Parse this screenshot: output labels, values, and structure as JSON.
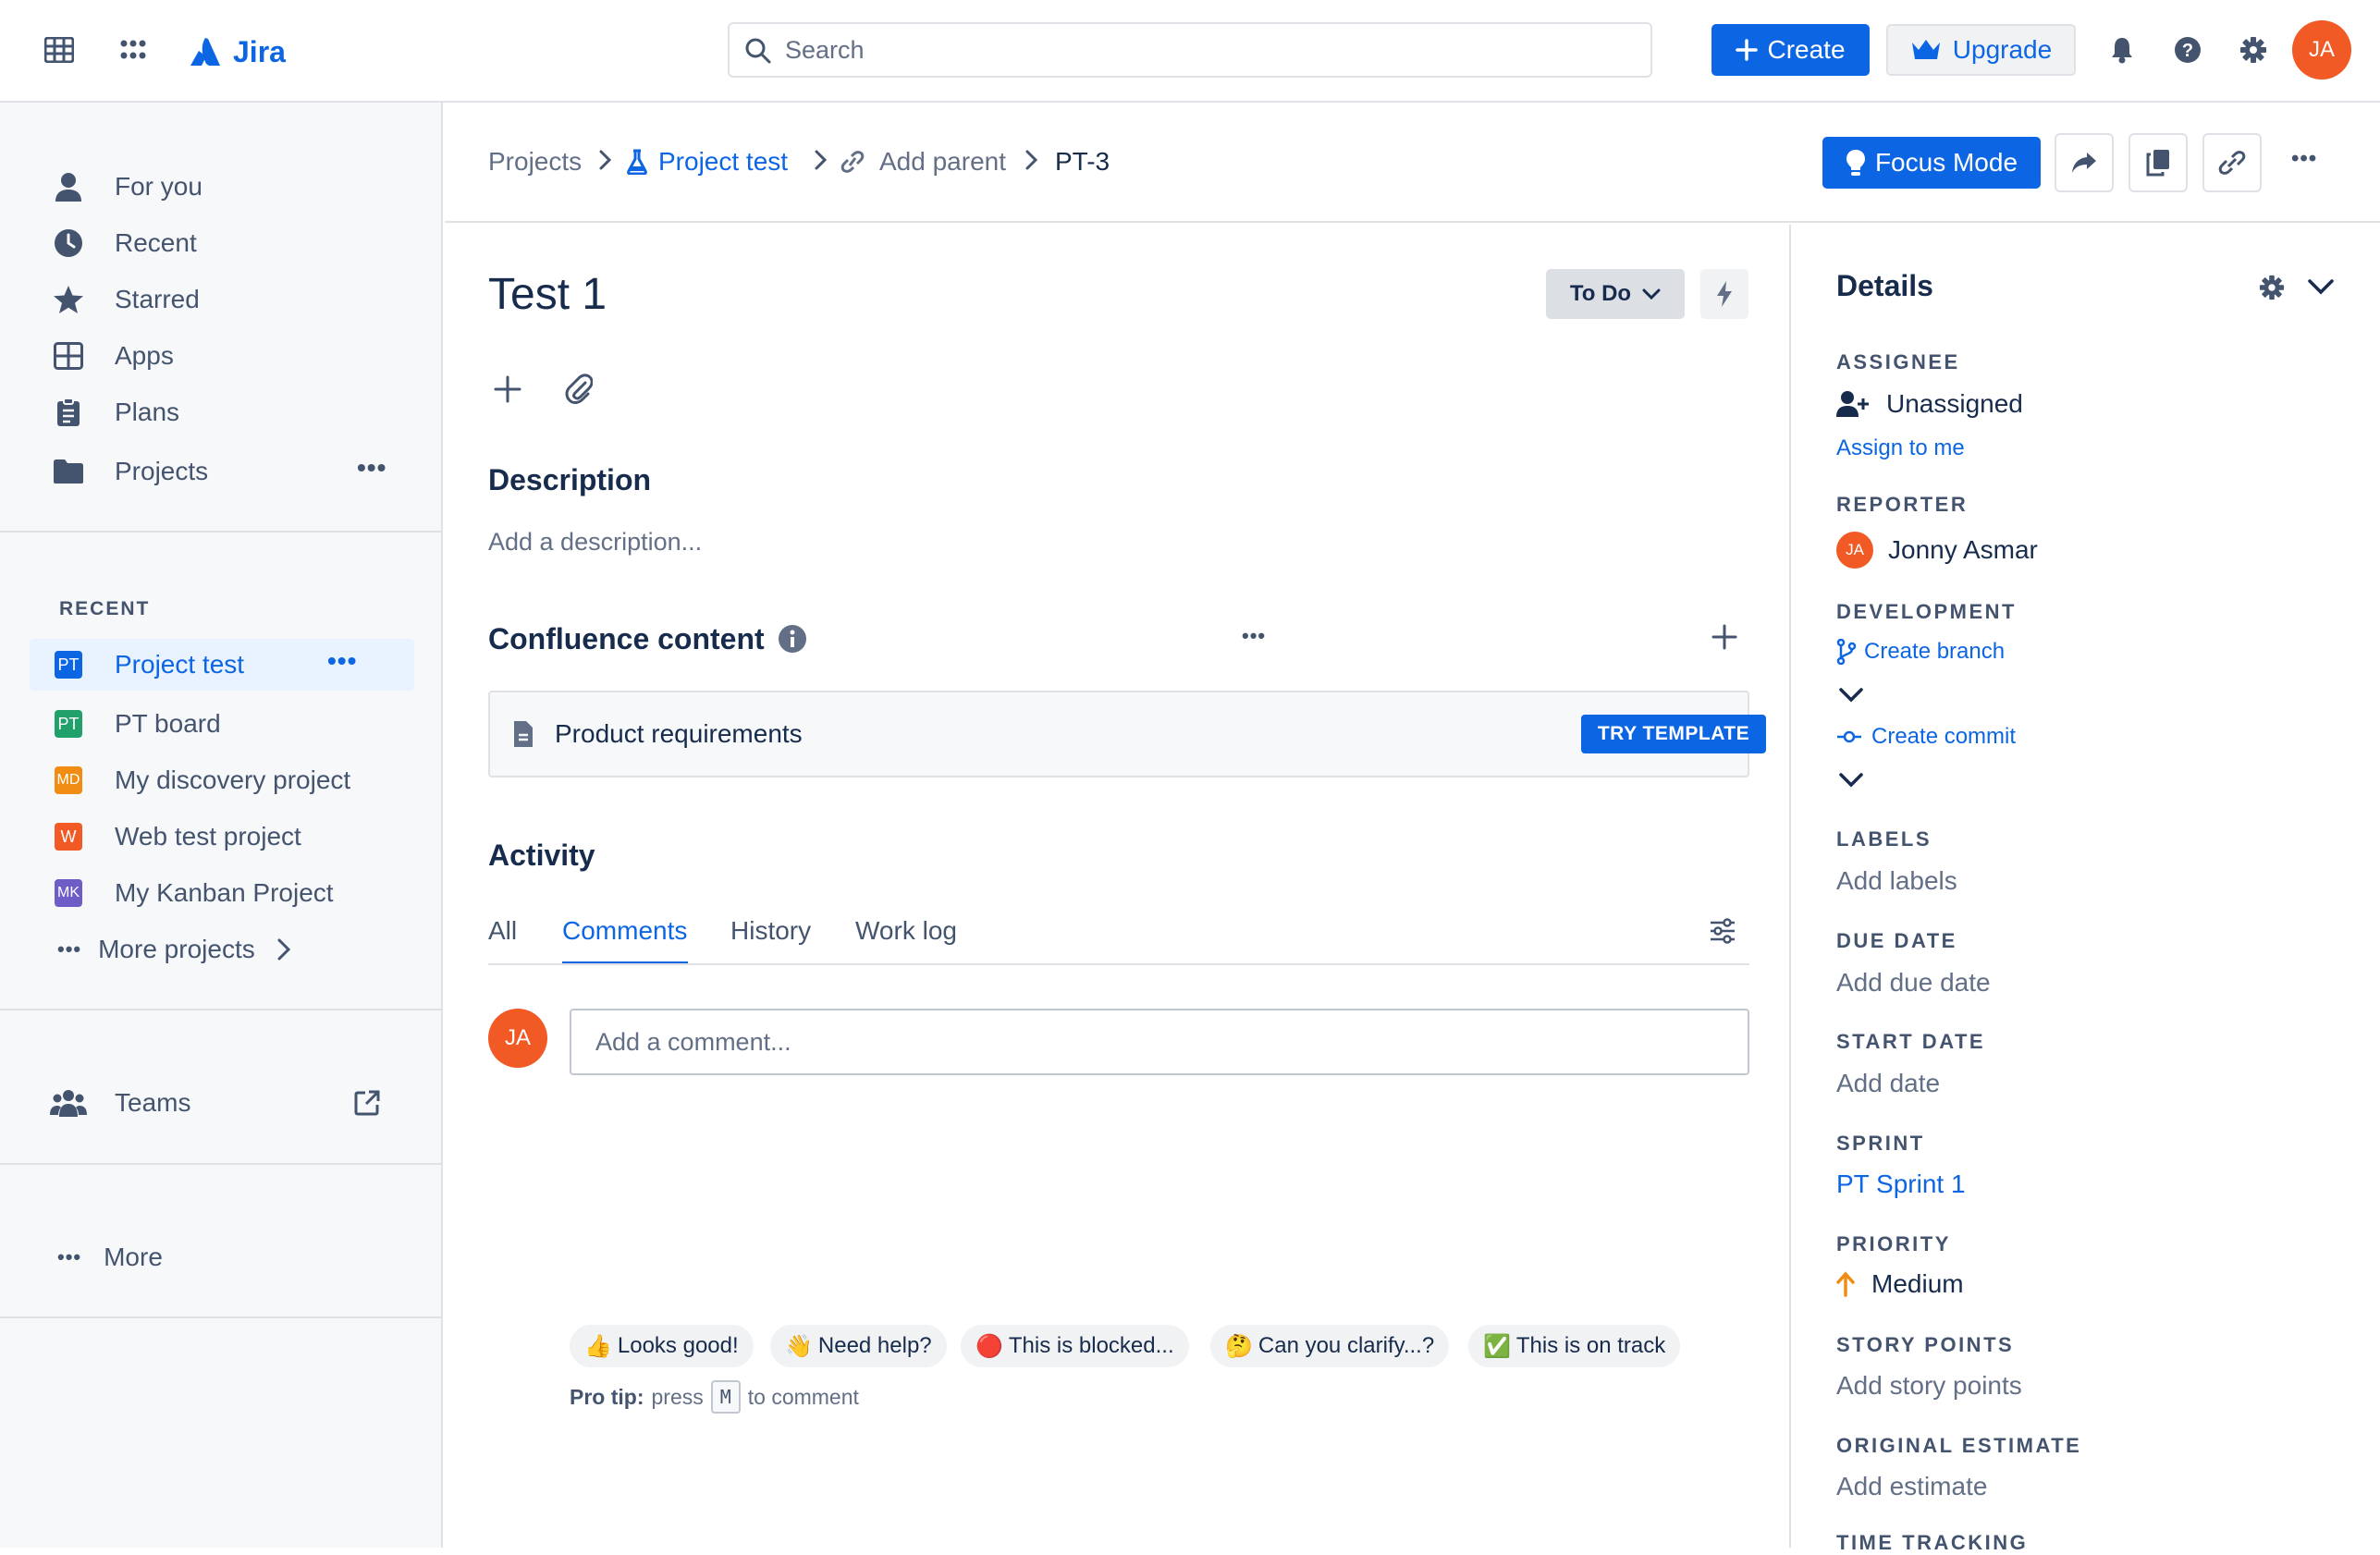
{
  "app": {
    "name": "Jira"
  },
  "topbar": {
    "search_placeholder": "Search",
    "create_label": "Create",
    "upgrade_label": "Upgrade",
    "avatar_initials": "JA"
  },
  "sidebar": {
    "nav": [
      {
        "label": "For you",
        "icon": "person-icon"
      },
      {
        "label": "Recent",
        "icon": "clock-icon"
      },
      {
        "label": "Starred",
        "icon": "star-icon"
      },
      {
        "label": "Apps",
        "icon": "apps-icon"
      },
      {
        "label": "Plans",
        "icon": "clipboard-icon"
      },
      {
        "label": "Projects",
        "icon": "folder-icon"
      }
    ],
    "recent_heading": "RECENT",
    "recent": [
      {
        "label": "Project test",
        "badge": "PT",
        "color": "#0C66E4",
        "selected": true
      },
      {
        "label": "PT board",
        "badge": "PT",
        "color": "#22A06B"
      },
      {
        "label": "My discovery project",
        "badge": "MD",
        "color": "#F18D13"
      },
      {
        "label": "Web test project",
        "badge": "W",
        "color": "#F15A24"
      },
      {
        "label": "My Kanban Project",
        "badge": "MK",
        "color": "#6E5DC6"
      }
    ],
    "more_projects": "More projects",
    "teams": "Teams",
    "more": "More"
  },
  "breadcrumb": {
    "projects": "Projects",
    "project": "Project test",
    "add_parent": "Add parent",
    "issue_key": "PT-3"
  },
  "header_actions": {
    "focus_mode": "Focus Mode"
  },
  "issue": {
    "title": "Test 1",
    "status": "To Do",
    "description_heading": "Description",
    "description_placeholder": "Add a description...",
    "confluence_heading": "Confluence content",
    "confluence_item": "Product requirements",
    "try_template": "TRY TEMPLATE",
    "activity_heading": "Activity",
    "tabs": [
      "All",
      "Comments",
      "History",
      "Work log"
    ],
    "active_tab": "Comments",
    "comment_placeholder": "Add a comment...",
    "quick_replies": [
      {
        "emoji": "👍",
        "text": "Looks good!"
      },
      {
        "emoji": "👋",
        "text": "Need help?"
      },
      {
        "emoji": "🔴",
        "text": "This is blocked..."
      },
      {
        "emoji": "🤔",
        "text": "Can you clarify...?"
      },
      {
        "emoji": "✅",
        "text": "This is on track"
      }
    ],
    "protip_bold": "Pro tip:",
    "protip_press": "press",
    "protip_key": "M",
    "protip_rest": "to comment"
  },
  "details": {
    "heading": "Details",
    "assignee_label": "ASSIGNEE",
    "assignee_value": "Unassigned",
    "assign_to_me": "Assign to me",
    "reporter_label": "REPORTER",
    "reporter_initials": "JA",
    "reporter_name": "Jonny Asmar",
    "development_label": "DEVELOPMENT",
    "create_branch": "Create branch",
    "create_commit": "Create commit",
    "labels_label": "LABELS",
    "labels_value": "Add labels",
    "due_label": "DUE DATE",
    "due_value": "Add due date",
    "start_label": "START DATE",
    "start_value": "Add date",
    "sprint_label": "SPRINT",
    "sprint_value": "PT Sprint 1",
    "priority_label": "PRIORITY",
    "priority_value": "Medium",
    "story_label": "STORY POINTS",
    "story_value": "Add story points",
    "estimate_label": "ORIGINAL ESTIMATE",
    "estimate_value": "Add estimate",
    "time_label": "TIME TRACKING"
  }
}
